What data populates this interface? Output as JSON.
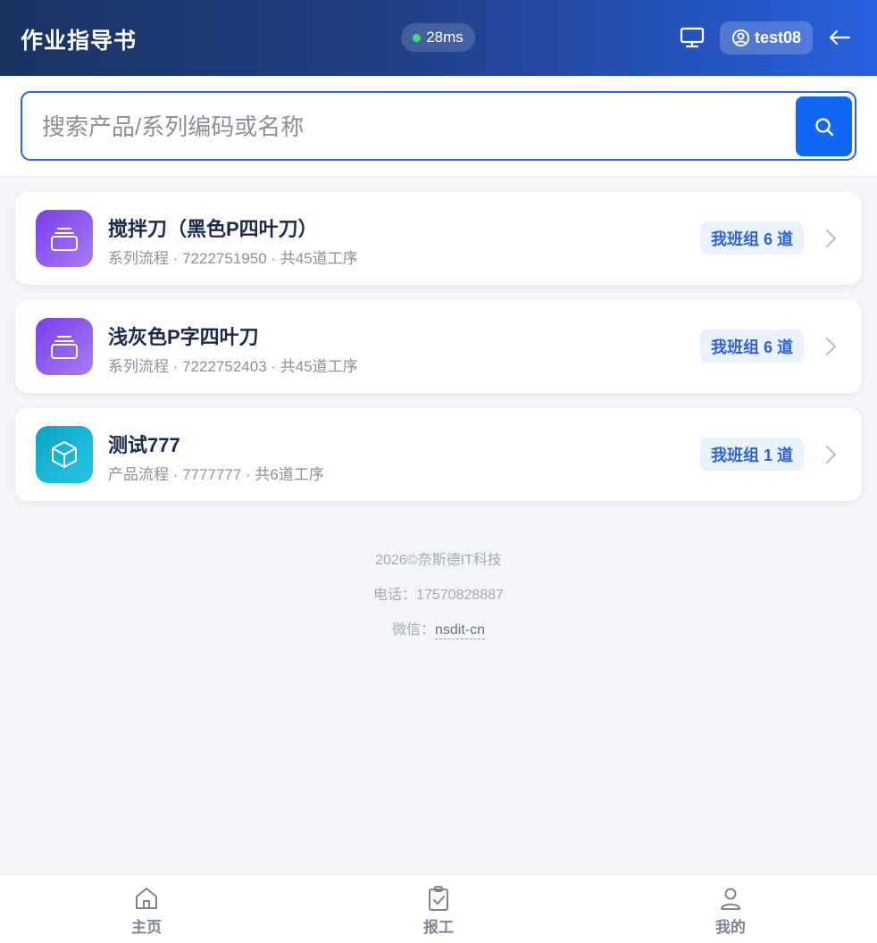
{
  "header": {
    "title": "作业指导书",
    "latency": "28ms",
    "username": "test08",
    "icons": {
      "monitor": "monitor-icon",
      "user": "user-circle-icon",
      "back": "arrow-left-icon",
      "status": "status-dot"
    },
    "colors": {
      "status_ok": "#3fdc7c"
    }
  },
  "search": {
    "placeholder": "搜索产品/系列编码或名称",
    "value": "",
    "button_icon": "search-icon",
    "accent": "#1166f4"
  },
  "items": [
    {
      "title": "搅拌刀（黑色P四叶刀）",
      "meta": "系列流程 · 7222751950 · 共45道工序",
      "badge": "我班组 6 道",
      "icon": "layers-icon"
    },
    {
      "title": "浅灰色P字四叶刀",
      "meta": "系列流程 · 7222752403 · 共45道工序",
      "badge": "我班组 6 道",
      "icon": "layers-icon"
    },
    {
      "title": "测试777",
      "meta": "产品流程 · 7777777 · 共6道工序",
      "badge": "我班组 1 道",
      "icon": "cube-icon"
    }
  ],
  "footer": {
    "copyright": "2026©奈斯德IT科技",
    "phone": "电话：17570828887",
    "wechat_label": "微信：",
    "wechat_id": "nsdit-cn"
  },
  "nav": [
    {
      "label": "主页",
      "icon": "home-icon"
    },
    {
      "label": "报工",
      "icon": "clipboard-check-icon"
    },
    {
      "label": "我的",
      "icon": "person-icon"
    }
  ]
}
